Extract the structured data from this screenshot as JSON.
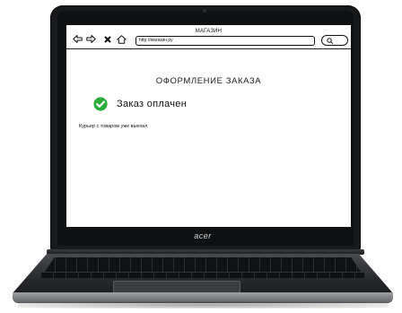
{
  "laptop": {
    "brand": "acer"
  },
  "browser": {
    "title": "МАГАЗИН",
    "url": "http://магазин.ру",
    "nav_icons": [
      "back-arrow-icon",
      "forward-arrow-icon",
      "close-icon",
      "home-icon"
    ],
    "search_icon": "search-icon"
  },
  "page": {
    "heading": "ОФОРМЛЕНИЕ ЗАКАЗА",
    "status": "Заказ оплачен",
    "info": "Курьер с товаром уже выехал"
  },
  "colors": {
    "check_green": "#2eac3a",
    "screen_bg": "#ffffff",
    "bezel": "#18191b"
  }
}
